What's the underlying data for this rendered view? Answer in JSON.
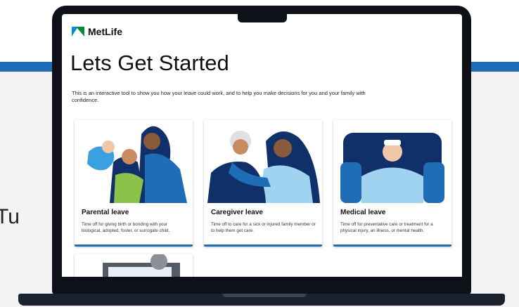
{
  "side_text": "Tu",
  "app": {
    "logo_text": "MetLife",
    "title": "Lets Get Started",
    "intro": "This is an interactive tool to show you how your leave could work, and to help you make decisions for you and your family with confidence."
  },
  "cards": [
    {
      "title": "Parental leave",
      "description": "Time off for giving birth or bonding with your biological, adopted, foster, or surrogate child."
    },
    {
      "title": "Caregiver leave",
      "description": "Time off to care for a sick or injured family member or to help them get care."
    },
    {
      "title": "Medical leave",
      "description": "Time off for preventative care or treatment for a physical injury, an illness, or mental health."
    }
  ],
  "colors": {
    "accent": "#1f6db6",
    "logo_blue": "#0090da",
    "logo_green": "#0a8a3a",
    "bezel": "#0e1117"
  }
}
